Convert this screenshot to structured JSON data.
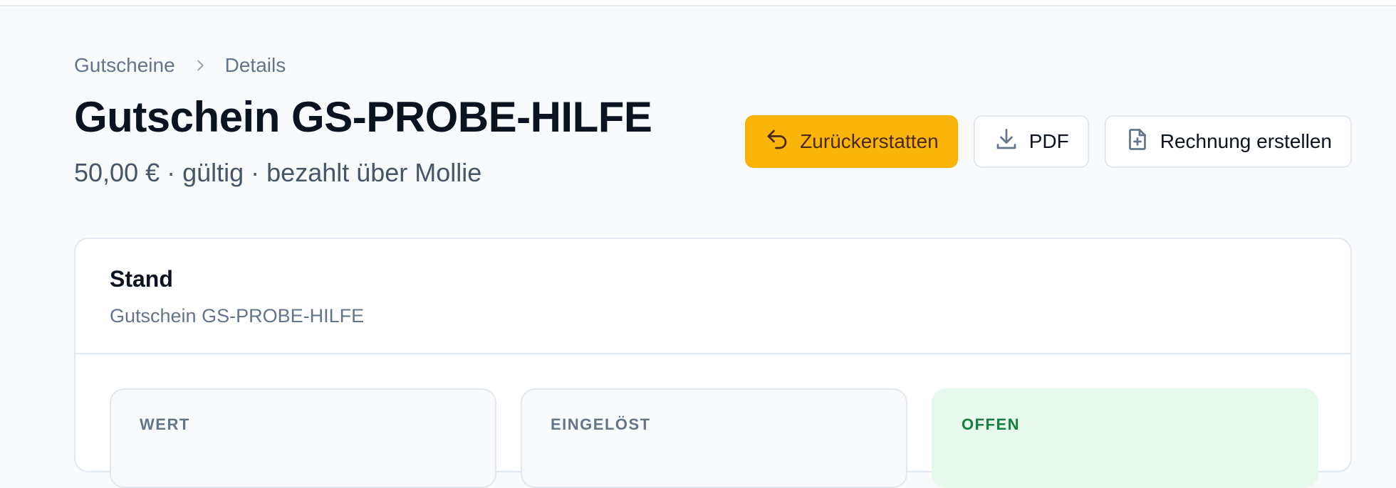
{
  "breadcrumb": {
    "parent": "Gutscheine",
    "current": "Details"
  },
  "header": {
    "title": "Gutschein GS-PROBE-HILFE",
    "subtitle": "50,00 € · gültig · bezahlt über Mollie"
  },
  "actions": {
    "refund": {
      "label": "Zurückerstatten",
      "icon": "undo-arrow-icon"
    },
    "pdf": {
      "label": "PDF",
      "icon": "download-icon"
    },
    "invoice": {
      "label": "Rechnung erstellen",
      "icon": "file-plus-icon"
    }
  },
  "status_card": {
    "title": "Stand",
    "subtitle": "Gutschein GS-PROBE-HILFE",
    "stats": [
      {
        "label": "WERT"
      },
      {
        "label": "EINGELÖST"
      },
      {
        "label": "OFFEN"
      }
    ]
  },
  "colors": {
    "accent": "#fbb50a",
    "open_bg": "#e7f8ec",
    "open_text": "#15803d"
  }
}
